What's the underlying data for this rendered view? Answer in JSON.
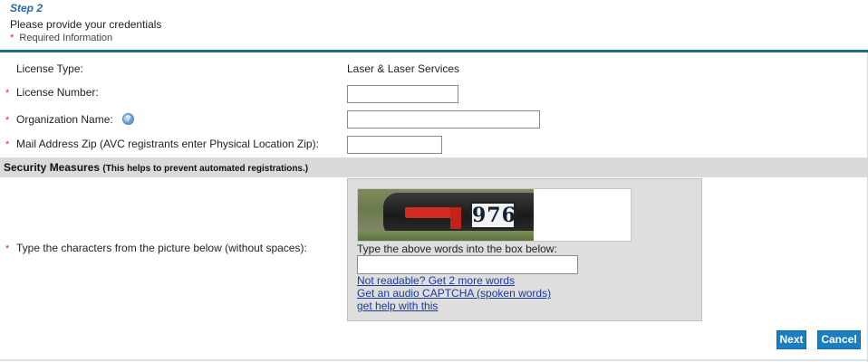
{
  "header": {
    "step_title": "Step 2",
    "subtitle": "Please provide your credentials",
    "required_star": "*",
    "required_text": "Required Information"
  },
  "form": {
    "license_type": {
      "label": "License Type:",
      "value": "Laser & Laser Services"
    },
    "license_number": {
      "star": "*",
      "label": "License Number:",
      "value": ""
    },
    "organization_name": {
      "star": "*",
      "label": "Organization Name:",
      "help_icon": "help-icon",
      "help_glyph": "?",
      "value": ""
    },
    "mail_zip": {
      "star": "*",
      "label": "Mail Address Zip (AVC registrants enter Physical Location Zip):",
      "value": ""
    }
  },
  "security": {
    "title": "Security Measures",
    "note": "(This helps to prevent automated registrations.)",
    "captcha": {
      "star": "*",
      "label": "Type the characters from the picture below (without spaces):",
      "image_text": "976",
      "caption": "Type the above words into the box below:",
      "input_value": "",
      "links": [
        "Not readable? Get 2 more words",
        "Get an audio CAPTCHA (spoken words)",
        "get help with this"
      ]
    }
  },
  "actions": {
    "next_label": "Next",
    "cancel_label": "Cancel"
  },
  "colors": {
    "accent": "#1f6e8c",
    "button": "#1a7fc0",
    "step_title": "#2a6aa0",
    "required_star": "#cc3333",
    "link": "#1a3a99",
    "section_bar": "#dadada"
  }
}
